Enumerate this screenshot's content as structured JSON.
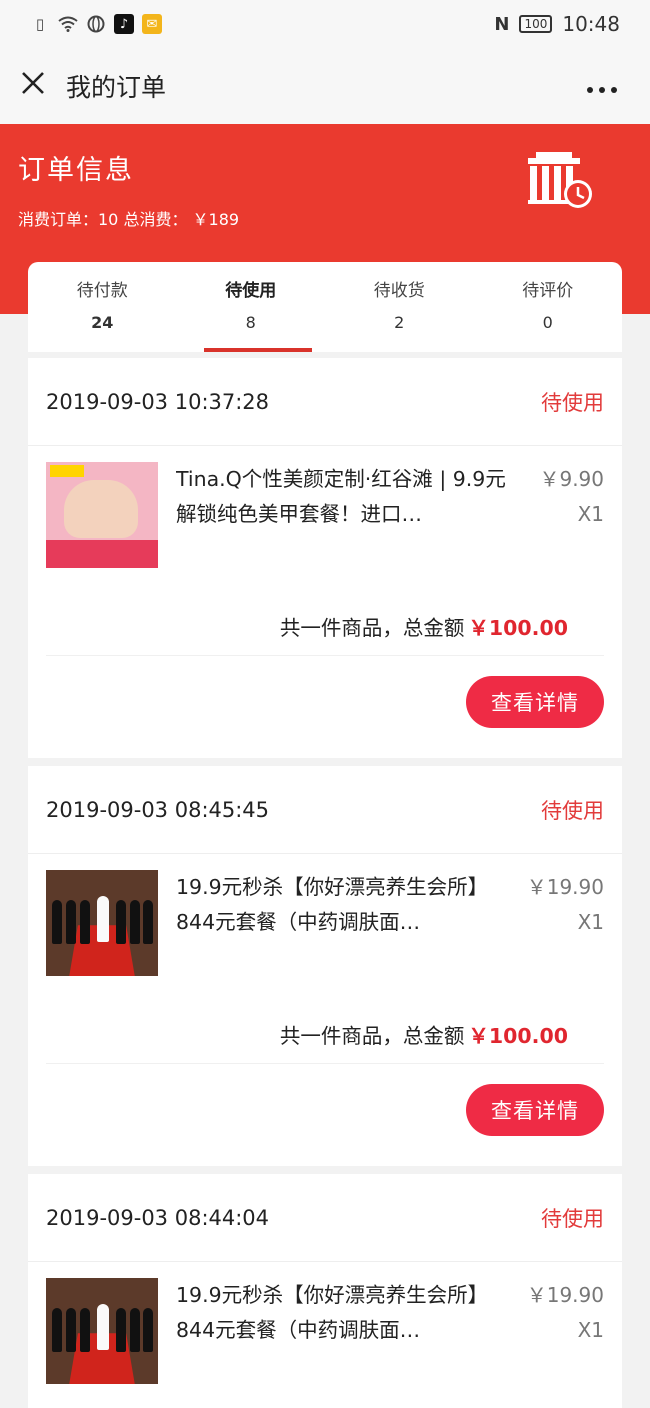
{
  "status_bar": {
    "time": "10:48",
    "battery": "100",
    "icons": [
      "sim-alert-icon",
      "wifi-icon",
      "globe-icon",
      "tiktok-icon",
      "mail-icon",
      "nfc-icon",
      "battery-icon"
    ]
  },
  "nav": {
    "close_icon": "close-icon",
    "title": "我的订单",
    "more_icon": "more-icon"
  },
  "header": {
    "title": "订单信息",
    "summary": "消费订单：10 总消费： ￥189",
    "icon": "store-clock-icon",
    "background": "#ea3a2f"
  },
  "tabs": [
    {
      "label": "待付款",
      "count": "24"
    },
    {
      "label": "待使用",
      "count": "8"
    },
    {
      "label": "待收货",
      "count": "2"
    },
    {
      "label": "待评价",
      "count": "0"
    }
  ],
  "orders": [
    {
      "time": "2019-09-03 10:37:28",
      "status": "待使用",
      "title": "Tina.Q个性美颜定制·红谷滩 | 9.9元解锁纯色美甲套餐！进口…",
      "price": "￥9.90",
      "qty": "X1",
      "total_label": "共一件商品，总金额",
      "total_amount": "￥100.00",
      "button": "查看详情"
    },
    {
      "time": "2019-09-03 08:45:45",
      "status": "待使用",
      "title": "19.9元秒杀【你好漂亮养生会所】844元套餐（中药调肤面…",
      "price": "￥19.90",
      "qty": "X1",
      "total_label": "共一件商品，总金额",
      "total_amount": "￥100.00",
      "button": "查看详情"
    },
    {
      "time": "2019-09-03 08:44:04",
      "status": "待使用",
      "title": "19.9元秒杀【你好漂亮养生会所】844元套餐（中药调肤面…",
      "price": "￥19.90",
      "qty": "X1"
    }
  ],
  "colors": {
    "accent_red": "#e23b3b",
    "button_red": "#ef2b45",
    "amount_red": "#e0262f"
  }
}
